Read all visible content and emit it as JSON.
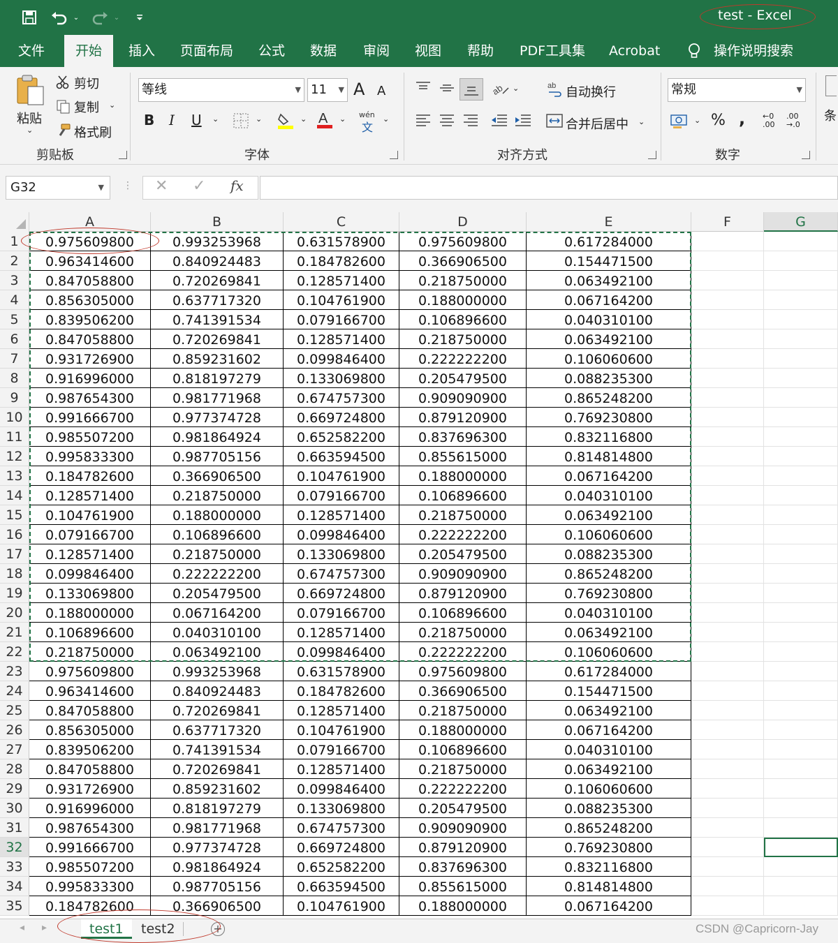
{
  "window": {
    "title": "test  -  Excel"
  },
  "quick_access": {
    "save_icon": "save-icon",
    "undo_icon": "undo-icon",
    "redo_icon": "redo-icon",
    "customize_icon": "customize-icon"
  },
  "menu_tabs": [
    "文件",
    "开始",
    "插入",
    "页面布局",
    "公式",
    "数据",
    "审阅",
    "视图",
    "帮助",
    "PDF工具集",
    "Acrobat"
  ],
  "active_tab": "开始",
  "tell_me": "操作说明搜索",
  "ribbon": {
    "clipboard": {
      "paste": "粘贴",
      "cut": "剪切",
      "copy": "复制",
      "format_painter": "格式刷",
      "group_label": "剪贴板"
    },
    "font": {
      "font_name": "等线",
      "font_size": "11",
      "bold": "B",
      "italic": "I",
      "underline": "U",
      "increase_size": "A",
      "decrease_size": "A",
      "group_label": "字体",
      "phonetic_top": "wén",
      "phonetic_bottom": "文"
    },
    "alignment": {
      "wrap_text": "自动换行",
      "merge_center": "合并后居中",
      "group_label": "对齐方式"
    },
    "number": {
      "format": "常规",
      "percent": "%",
      "comma": ",",
      "inc_decimal_top": "←0",
      "inc_decimal_bottom": ".00",
      "dec_decimal_top": ".00",
      "dec_decimal_bottom": "→.0",
      "group_label": "数字"
    },
    "styles_partial": "条"
  },
  "formula_bar": {
    "name_box": "G32",
    "cancel": "✕",
    "enter": "✓",
    "fx": "fx",
    "value": ""
  },
  "columns": [
    "A",
    "B",
    "C",
    "D",
    "E",
    "F",
    "G"
  ],
  "selected_column": "G",
  "selected_row": "32",
  "row_numbers": [
    "1",
    "2",
    "3",
    "4",
    "5",
    "6",
    "7",
    "8",
    "9",
    "10",
    "11",
    "12",
    "13",
    "14",
    "15",
    "16",
    "17",
    "18",
    "19",
    "20",
    "21",
    "22",
    "23",
    "24",
    "25",
    "26",
    "27",
    "28",
    "29",
    "30",
    "31",
    "32",
    "33",
    "34",
    "35"
  ],
  "rows": [
    [
      "0.975609800",
      "0.993253968",
      "0.631578900",
      "0.975609800",
      "0.617284000"
    ],
    [
      "0.963414600",
      "0.840924483",
      "0.184782600",
      "0.366906500",
      "0.154471500"
    ],
    [
      "0.847058800",
      "0.720269841",
      "0.128571400",
      "0.218750000",
      "0.063492100"
    ],
    [
      "0.856305000",
      "0.637717320",
      "0.104761900",
      "0.188000000",
      "0.067164200"
    ],
    [
      "0.839506200",
      "0.741391534",
      "0.079166700",
      "0.106896600",
      "0.040310100"
    ],
    [
      "0.847058800",
      "0.720269841",
      "0.128571400",
      "0.218750000",
      "0.063492100"
    ],
    [
      "0.931726900",
      "0.859231602",
      "0.099846400",
      "0.222222200",
      "0.106060600"
    ],
    [
      "0.916996000",
      "0.818197279",
      "0.133069800",
      "0.205479500",
      "0.088235300"
    ],
    [
      "0.987654300",
      "0.981771968",
      "0.674757300",
      "0.909090900",
      "0.865248200"
    ],
    [
      "0.991666700",
      "0.977374728",
      "0.669724800",
      "0.879120900",
      "0.769230800"
    ],
    [
      "0.985507200",
      "0.981864924",
      "0.652582200",
      "0.837696300",
      "0.832116800"
    ],
    [
      "0.995833300",
      "0.987705156",
      "0.663594500",
      "0.855615000",
      "0.814814800"
    ],
    [
      "0.184782600",
      "0.366906500",
      "0.104761900",
      "0.188000000",
      "0.067164200"
    ],
    [
      "0.128571400",
      "0.218750000",
      "0.079166700",
      "0.106896600",
      "0.040310100"
    ],
    [
      "0.104761900",
      "0.188000000",
      "0.128571400",
      "0.218750000",
      "0.063492100"
    ],
    [
      "0.079166700",
      "0.106896600",
      "0.099846400",
      "0.222222200",
      "0.106060600"
    ],
    [
      "0.128571400",
      "0.218750000",
      "0.133069800",
      "0.205479500",
      "0.088235300"
    ],
    [
      "0.099846400",
      "0.222222200",
      "0.674757300",
      "0.909090900",
      "0.865248200"
    ],
    [
      "0.133069800",
      "0.205479500",
      "0.669724800",
      "0.879120900",
      "0.769230800"
    ],
    [
      "0.188000000",
      "0.067164200",
      "0.079166700",
      "0.106896600",
      "0.040310100"
    ],
    [
      "0.106896600",
      "0.040310100",
      "0.128571400",
      "0.218750000",
      "0.063492100"
    ],
    [
      "0.218750000",
      "0.063492100",
      "0.099846400",
      "0.222222200",
      "0.106060600"
    ],
    [
      "0.975609800",
      "0.993253968",
      "0.631578900",
      "0.975609800",
      "0.617284000"
    ],
    [
      "0.963414600",
      "0.840924483",
      "0.184782600",
      "0.366906500",
      "0.154471500"
    ],
    [
      "0.847058800",
      "0.720269841",
      "0.128571400",
      "0.218750000",
      "0.063492100"
    ],
    [
      "0.856305000",
      "0.637717320",
      "0.104761900",
      "0.188000000",
      "0.067164200"
    ],
    [
      "0.839506200",
      "0.741391534",
      "0.079166700",
      "0.106896600",
      "0.040310100"
    ],
    [
      "0.847058800",
      "0.720269841",
      "0.128571400",
      "0.218750000",
      "0.063492100"
    ],
    [
      "0.931726900",
      "0.859231602",
      "0.099846400",
      "0.222222200",
      "0.106060600"
    ],
    [
      "0.916996000",
      "0.818197279",
      "0.133069800",
      "0.205479500",
      "0.088235300"
    ],
    [
      "0.987654300",
      "0.981771968",
      "0.674757300",
      "0.909090900",
      "0.865248200"
    ],
    [
      "0.991666700",
      "0.977374728",
      "0.669724800",
      "0.879120900",
      "0.769230800"
    ],
    [
      "0.985507200",
      "0.981864924",
      "0.652582200",
      "0.837696300",
      "0.832116800"
    ],
    [
      "0.995833300",
      "0.987705156",
      "0.663594500",
      "0.855615000",
      "0.814814800"
    ],
    [
      "0.184782600",
      "0.366906500",
      "0.104761900",
      "0.188000000",
      "0.067164200"
    ]
  ],
  "sheets": [
    "test1",
    "test2"
  ],
  "active_sheet": "test1",
  "watermark": "CSDN @Capricorn-Jay",
  "colors": {
    "accent": "#217346",
    "annotation": "#c0392b"
  }
}
